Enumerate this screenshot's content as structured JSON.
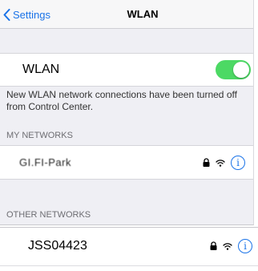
{
  "navbar": {
    "back_label": "Settings",
    "title": "WLAN"
  },
  "wlan": {
    "label": "WLAN",
    "toggle_on": true,
    "note": "New WLAN network connections have been turned off from Control Center."
  },
  "my_networks": {
    "header": "MY NETWORKS",
    "items": [
      {
        "name": "GI.FI-Park",
        "secured": true,
        "icons": [
          "lock-icon",
          "wifi-icon",
          "info-icon"
        ]
      }
    ]
  },
  "other_networks": {
    "header": "OTHER NETWORKS",
    "items": [
      {
        "name": "JSS04423",
        "secured": true,
        "icons": [
          "lock-icon",
          "wifi-icon",
          "info-icon"
        ]
      }
    ]
  },
  "icons": {
    "info_glyph": "i"
  },
  "colors": {
    "accent": "#1a73e8",
    "toggle_on": "#4cd964",
    "grouped_background": "#efeff4"
  }
}
